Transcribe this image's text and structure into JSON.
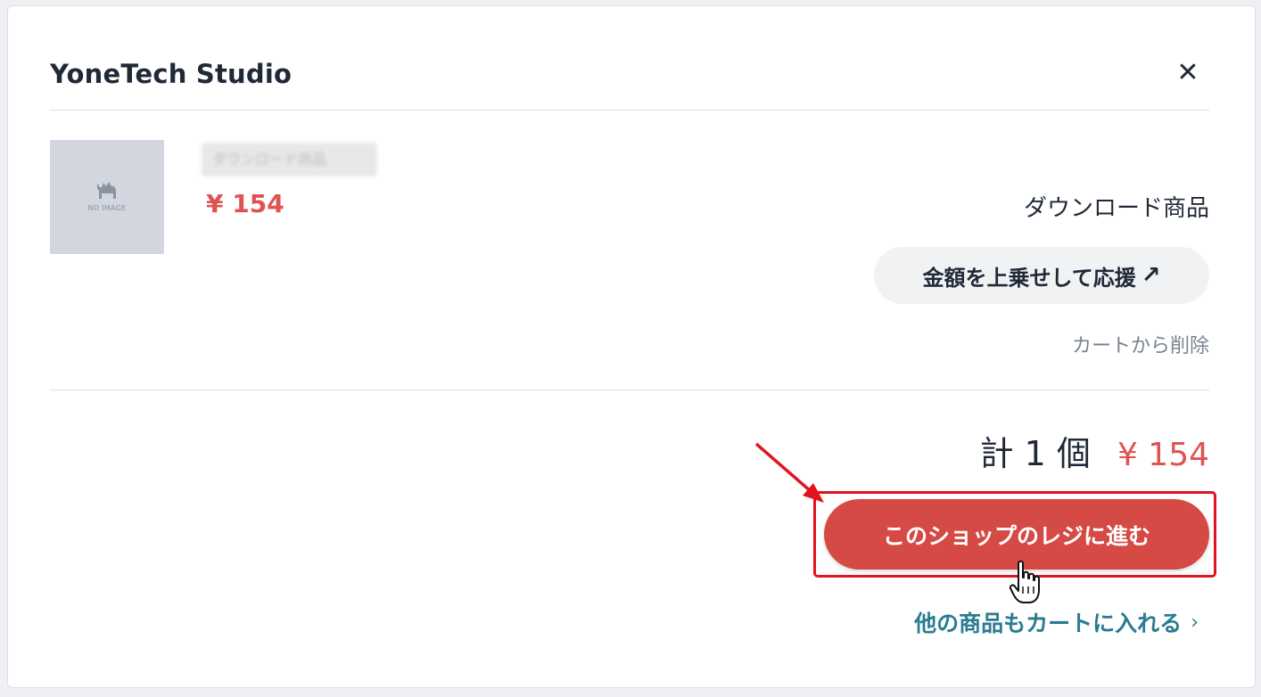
{
  "shop": {
    "name": "YoneTech Studio",
    "close_icon": "close-icon"
  },
  "item": {
    "no_image_label": "NO IMAGE",
    "name": "ダウンロード商品",
    "price": "¥ 154",
    "type": "ダウンロード商品",
    "support_button": "金額を上乗せして応援",
    "support_icon": "arrow-up-right-icon",
    "remove_link": "カートから削除"
  },
  "summary": {
    "count": "計 1 個",
    "total": "¥ 154"
  },
  "actions": {
    "checkout": "このショップのレジに進む",
    "continue": "他の商品もカートに入れる",
    "continue_icon": "chevron-right-icon"
  },
  "colors": {
    "accent_red": "#d64a45",
    "price_red": "#e05353",
    "link_teal": "#2a7c91",
    "annotation_red": "#e0141e"
  }
}
